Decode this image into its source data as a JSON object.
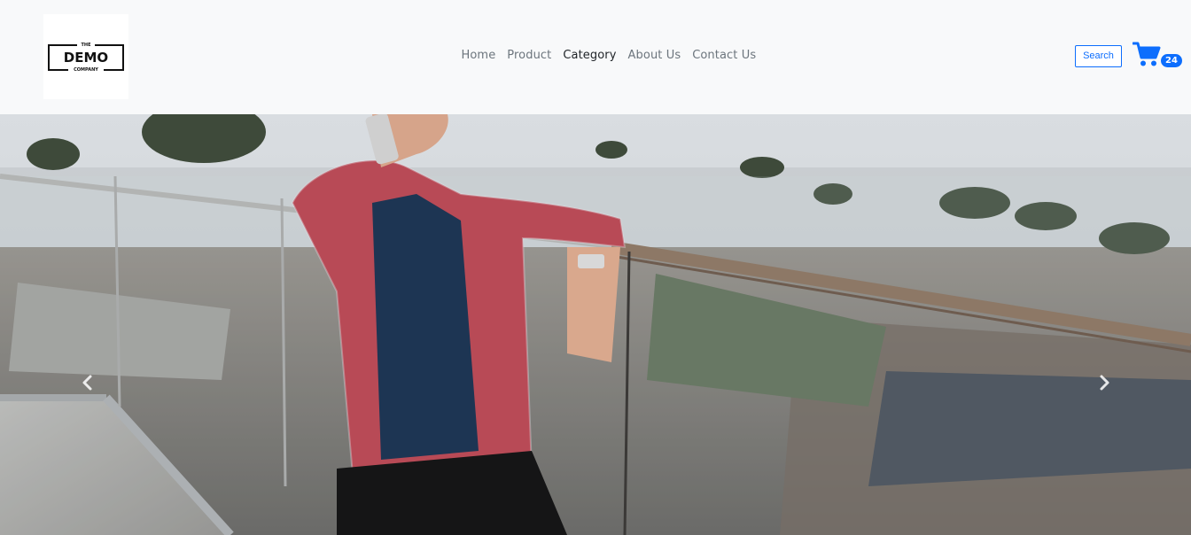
{
  "brand": {
    "logo_top": "THE",
    "logo_main": "DEMO",
    "logo_bottom": "COMPANY"
  },
  "nav": {
    "items": [
      {
        "label": "Home",
        "active": false
      },
      {
        "label": "Product",
        "active": false
      },
      {
        "label": "Category",
        "active": true
      },
      {
        "label": "About Us",
        "active": false
      },
      {
        "label": "Contact Us",
        "active": false
      }
    ]
  },
  "search": {
    "label": "Search"
  },
  "cart": {
    "icon": "cart-icon",
    "count": "24"
  },
  "carousel": {
    "prev_icon": "chevron-left-icon",
    "next_icon": "chevron-right-icon"
  },
  "colors": {
    "accent": "#0d6efd",
    "nav_text": "#6c757d",
    "nav_active": "#212529",
    "navbar_bg": "#f8f9fa"
  }
}
